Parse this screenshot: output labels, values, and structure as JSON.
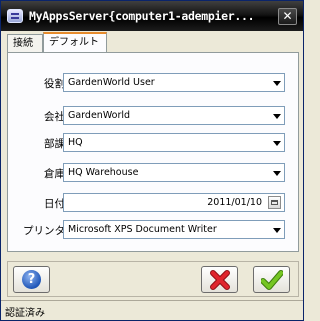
{
  "window": {
    "title": "MyAppsServer{computer1-adempier...",
    "close_symbol": "✕"
  },
  "tabs": [
    {
      "label": "接続",
      "selected": false
    },
    {
      "label": "デフォルト",
      "selected": true
    }
  ],
  "form": {
    "role": {
      "label": "役割",
      "value": "GardenWorld User"
    },
    "client": {
      "label": "会社",
      "value": "GardenWorld"
    },
    "org": {
      "label": "部課",
      "value": "HQ"
    },
    "warehouse": {
      "label": "倉庫",
      "value": "HQ Warehouse"
    },
    "date": {
      "label": "日付",
      "value": "2011/01/10"
    },
    "printer": {
      "label": "プリンタ",
      "value": "Microsoft XPS Document Writer"
    }
  },
  "buttons": {
    "help_symbol": "?",
    "help_icon": "help-icon",
    "cancel_icon": "red-x-icon",
    "ok_icon": "green-check-icon"
  },
  "status": {
    "text": "認証済み"
  },
  "colors": {
    "titlebar": "#000000",
    "tab_accent": "#e68b2c",
    "cancel_red": "#d8222a",
    "ok_green": "#6fbf1e"
  }
}
